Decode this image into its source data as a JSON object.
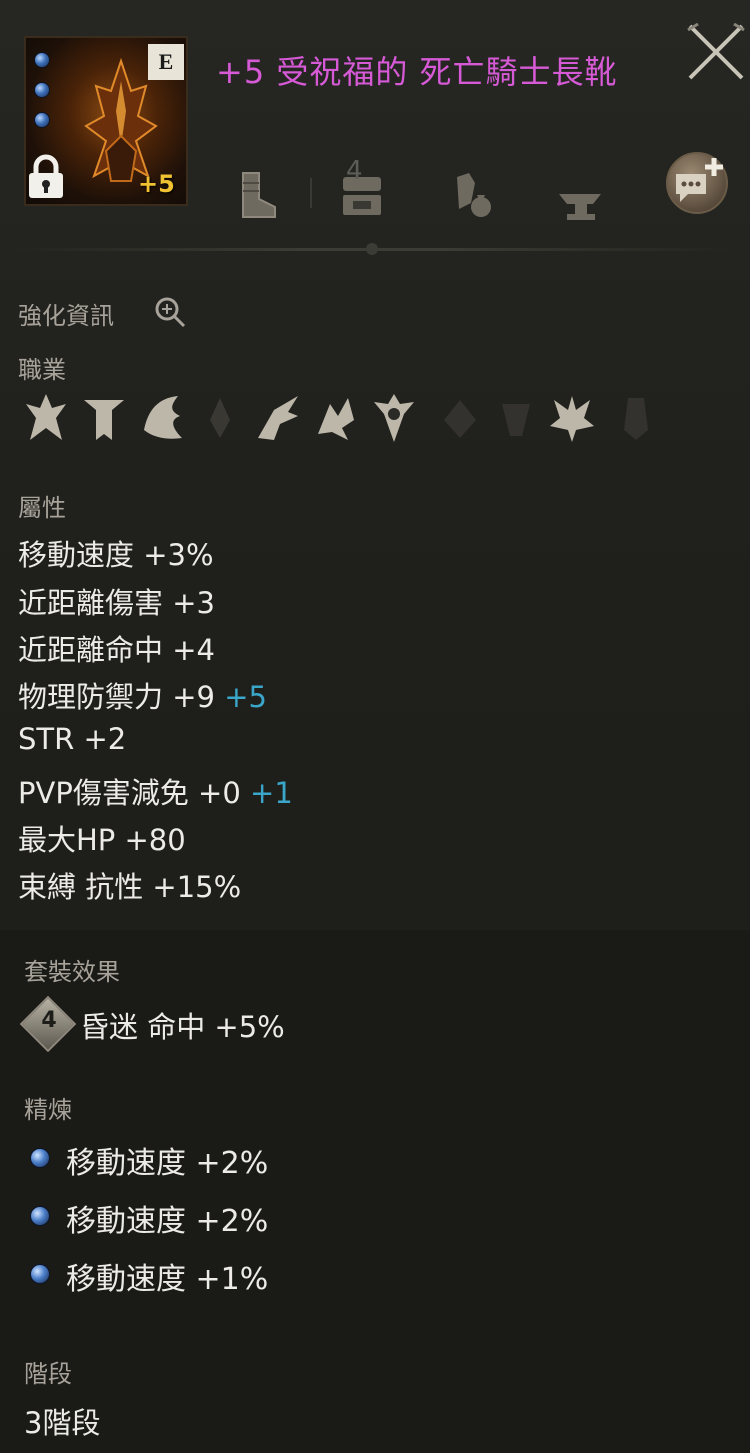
{
  "item": {
    "grade": "E",
    "enhance": "+5",
    "name": "+5 受祝福的 死亡騎士長靴"
  },
  "toolbar": {
    "boots_icon": "boots-icon",
    "storage_icon": "chest-icon",
    "trade_icon": "hand-bag-icon",
    "anvil_icon": "anvil-icon",
    "anvil_count": "4",
    "chat_icon": "chat-plus-icon"
  },
  "enhance_info": {
    "title": "強化資訊"
  },
  "classes": {
    "title": "職業",
    "icons": [
      "class-1",
      "class-2",
      "class-3",
      "class-4",
      "class-5",
      "class-6",
      "class-7",
      "class-8",
      "class-9",
      "class-10",
      "class-11"
    ]
  },
  "attributes": {
    "title": "屬性",
    "lines": [
      {
        "text": "移動速度 +3%",
        "bonus": ""
      },
      {
        "text": "近距離傷害 +3",
        "bonus": ""
      },
      {
        "text": "近距離命中 +4",
        "bonus": ""
      },
      {
        "text": "物理防禦力 +9",
        "bonus": "+5"
      },
      {
        "text": "STR +2",
        "bonus": ""
      },
      {
        "text": "PVP傷害減免 +0",
        "bonus": "+1"
      },
      {
        "text": "最大HP +80",
        "bonus": ""
      },
      {
        "text": "束縛 抗性 +15%",
        "bonus": ""
      }
    ]
  },
  "set_effect": {
    "title": "套裝效果",
    "count": "4",
    "text": "昏迷 命中 +5%"
  },
  "refine": {
    "title": "精煉",
    "lines": [
      "移動速度 +2%",
      "移動速度 +2%",
      "移動速度 +1%"
    ]
  },
  "tier": {
    "title": "階段",
    "value": "3階段"
  }
}
